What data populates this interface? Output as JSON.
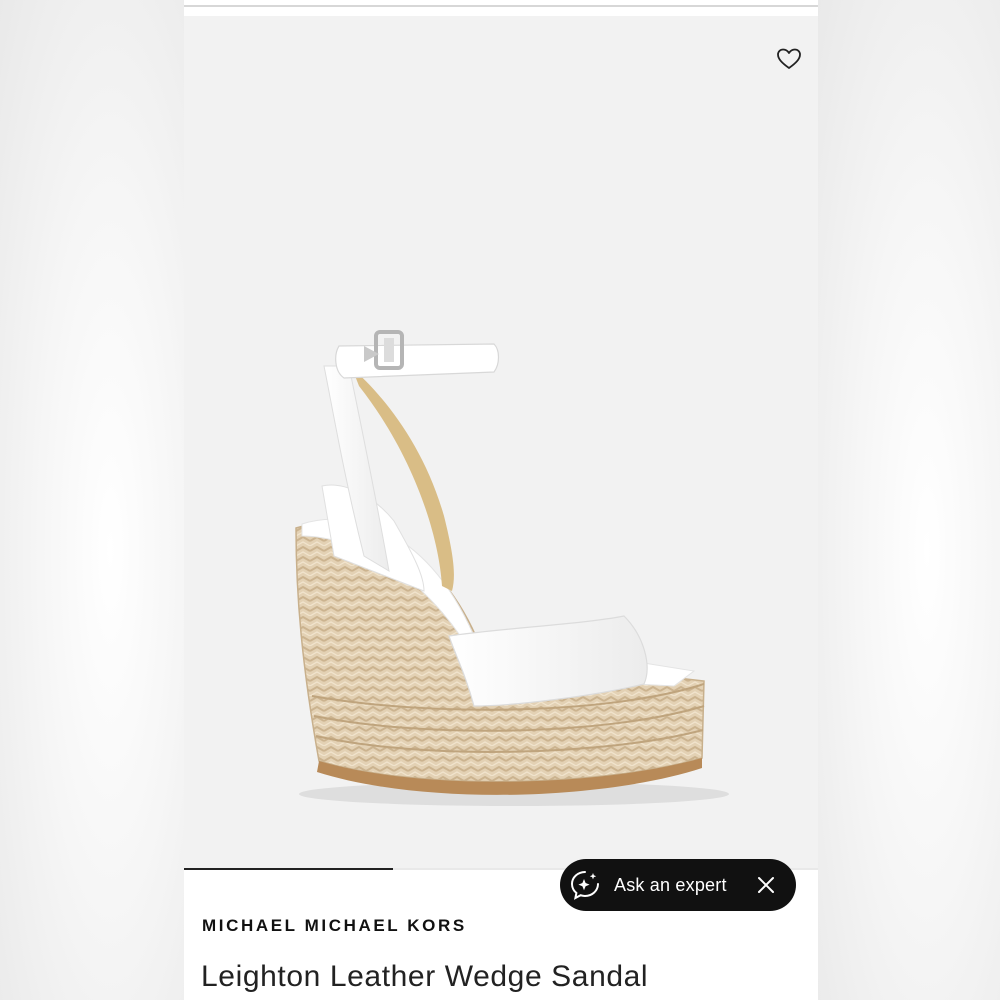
{
  "product": {
    "brand": "MICHAEL MICHAEL KORS",
    "name": "Leighton Leather Wedge Sandal",
    "image_alt": "Leighton Leather Wedge Sandal"
  },
  "gallery": {
    "progress_fraction": 0.33
  },
  "chat": {
    "ask_label": "Ask an expert"
  },
  "icons": {
    "wishlist": "heart-outline-icon",
    "ask": "sparkle-chat-icon",
    "close": "close-icon"
  },
  "colors": {
    "image_background": "#f2f2f2",
    "pill_background": "#111111",
    "text": "#111111"
  }
}
